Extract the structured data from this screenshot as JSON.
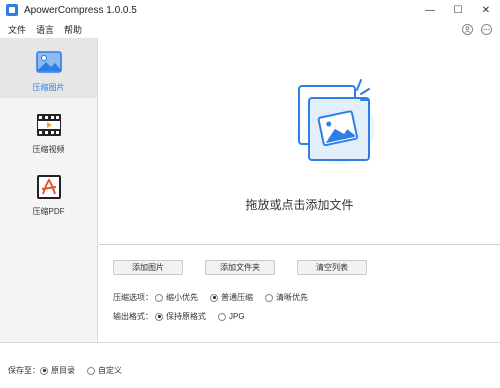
{
  "window": {
    "title": "ApowerCompress 1.0.0.5",
    "controls": {
      "minimize": "—",
      "maximize": "☐",
      "close": "✕"
    }
  },
  "menu": {
    "items": [
      "文件",
      "语言",
      "帮助"
    ],
    "icons": [
      "user-icon",
      "more-icon"
    ]
  },
  "sidebar": {
    "items": [
      {
        "label": "压缩图片",
        "icon": "image-icon",
        "active": true
      },
      {
        "label": "压缩视频",
        "icon": "video-icon",
        "active": false
      },
      {
        "label": "压缩PDF",
        "icon": "pdf-icon",
        "active": false
      }
    ]
  },
  "drop_area": {
    "text": "拖放或点击添加文件",
    "icon": "add-images-icon"
  },
  "buttons": {
    "add_image": "添加图片",
    "add_folder": "添加文件夹",
    "clear_list": "清空列表"
  },
  "compress_options": {
    "label": "压缩选项：",
    "options": [
      "缩小优先",
      "普通压缩",
      "清晰优先"
    ],
    "selected": "普通压缩"
  },
  "output_format": {
    "label": "输出格式：",
    "options": [
      "保持原格式",
      "JPG"
    ],
    "selected": "保持原格式"
  },
  "save_to": {
    "label": "保存至：",
    "options": [
      "原目录",
      "自定义"
    ],
    "selected": "原目录"
  },
  "colors": {
    "accent": "#2e7fe5",
    "accent_light": "#8fbaf0",
    "sidebar_bg": "#f4f4f4"
  }
}
